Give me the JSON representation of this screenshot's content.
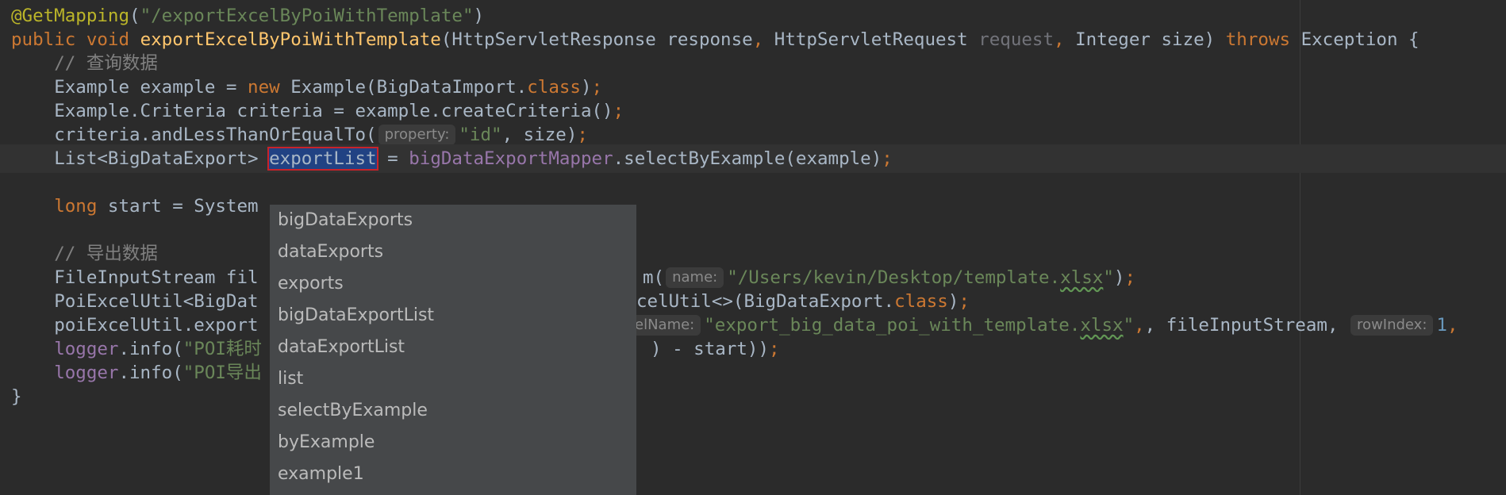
{
  "editor": {
    "line1": {
      "annotation": "@GetMapping",
      "open": "(",
      "str": "\"/exportExcelByPoiWithTemplate\"",
      "close": ")"
    },
    "line2": {
      "kw1": "public",
      "kw2": "void",
      "method": "exportExcelByPoiWithTemplate",
      "p1": "(HttpServletResponse response",
      "comma1": ",",
      "p2": " HttpServletRequest ",
      "unused_param": "request",
      "comma2": ",",
      "p3": " Integer size) ",
      "throws": "throws",
      "rest": " Exception {"
    },
    "line3": {
      "comment": "// 查询数据"
    },
    "line4": {
      "a": "Example example = ",
      "new": "new",
      "b": " Example(BigDataImport.",
      "cls": "class",
      "c": ")",
      "semi": ";"
    },
    "line5": {
      "a": "Example.Criteria criteria = example.createCriteria()",
      "semi": ";"
    },
    "line6": {
      "a": "criteria.andLessThanOrEqualTo(",
      "hint": "property:",
      "str": "\"id\"",
      "b": ", size)",
      "semi": ";"
    },
    "line7": {
      "a": "List<BigDataExport> ",
      "selected": "exportList",
      "b": " = ",
      "field": "bigDataExportMapper",
      "c": ".selectByExample(example)",
      "semi": ";"
    },
    "line9": {
      "kw": "long",
      "a": " start = System"
    },
    "line11": {
      "comment": "// 导出数据"
    },
    "line12": {
      "a": "FileInputStream fil",
      "b": "m(",
      "hint": "name:",
      "str_a": "\"/Users/kevin/Desktop/template.",
      "str_typo": "xlsx",
      "str_b": "\"",
      "c": ")",
      "semi": ";"
    },
    "line13": {
      "a": "PoiExcelUtil<BigDat",
      "b": "celUtil<>(BigDataExport.",
      "cls": "class",
      "c": ")",
      "semi": ";"
    },
    "line14": {
      "a": "poiExcelUtil.export",
      "hint": "elName:",
      "str_a": "\"export_big_data_poi_with_template.",
      "str_typo": "xlsx",
      "str_b": "\"",
      "b": ", fileInputStream, ",
      "hint2": "rowIndex:",
      "num": "1",
      "c": ","
    },
    "line15": {
      "field": "logger",
      "a": ".info(",
      "str": "\"POI耗时",
      "b": ") - start))",
      "semi": ";"
    },
    "line16": {
      "field": "logger",
      "a": ".info(",
      "str": "\"POI导出"
    },
    "line17": {
      "a": "}"
    }
  },
  "completion_popup": {
    "items": [
      "bigDataExports",
      "dataExports",
      "exports",
      "bigDataExportList",
      "dataExportList",
      "list",
      "selectByExample",
      "byExample",
      "example1"
    ]
  },
  "colors": {
    "background": "#2b2b2b",
    "keyword": "#cc7832",
    "string": "#6a8759",
    "method": "#ffc66d",
    "field": "#9876aa",
    "annotation": "#bbb529",
    "comment": "#808080",
    "popup": "#46484a",
    "selection_border": "#c8222a"
  }
}
